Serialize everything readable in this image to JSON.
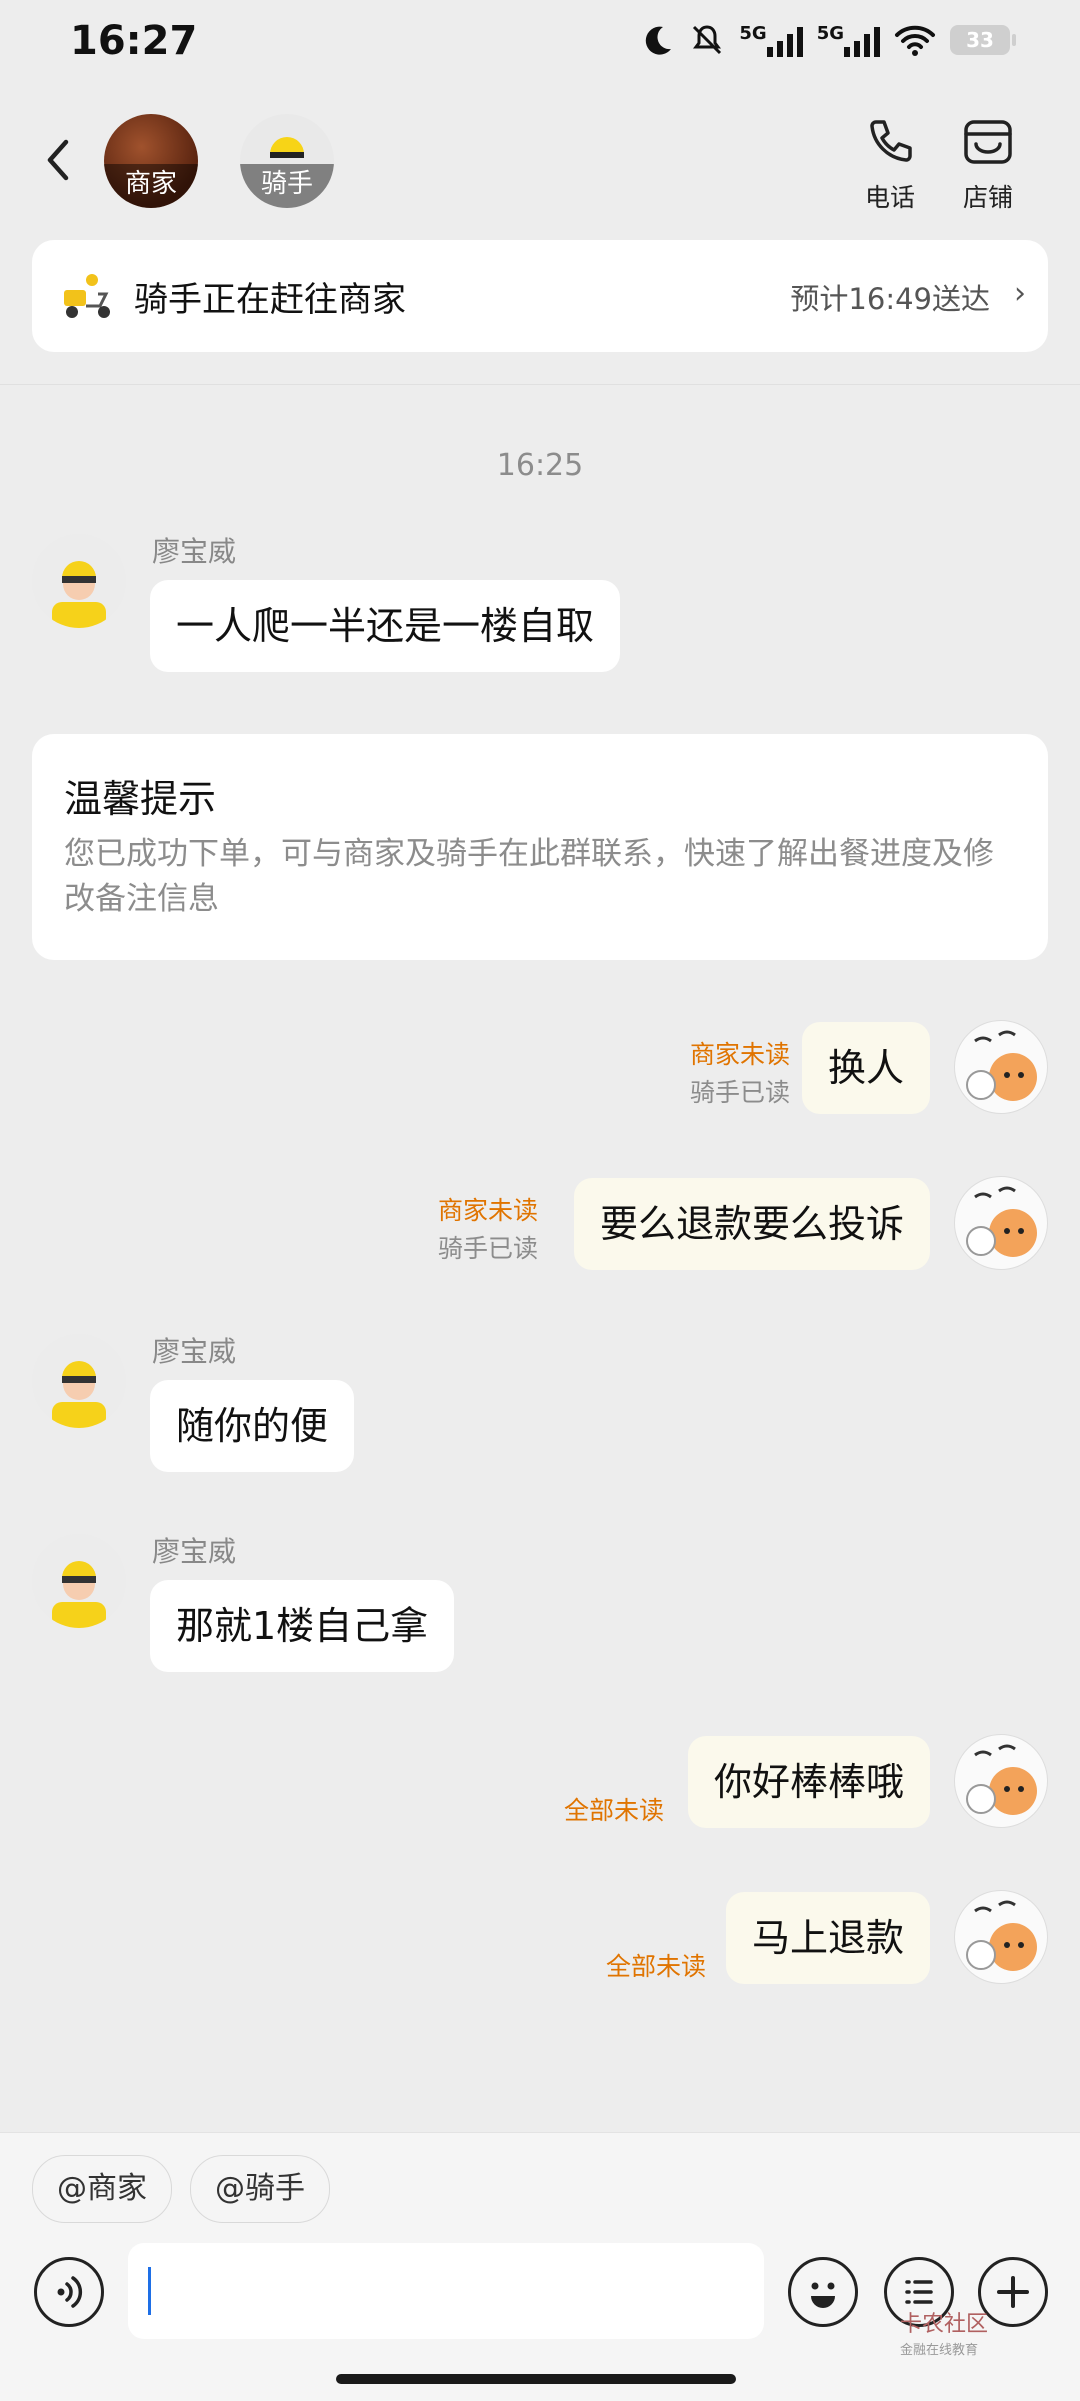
{
  "status_bar": {
    "time": "16:27",
    "network_1": "5G",
    "network_2": "5G",
    "battery": "33"
  },
  "header": {
    "merchant_avatar_label": "商家",
    "rider_avatar_label": "骑手",
    "phone_label": "电话",
    "store_label": "店铺"
  },
  "delivery": {
    "status": "骑手正在赶往商家",
    "eta": "预计16:49送达"
  },
  "chat": {
    "timestamp": "16:25",
    "rider_name": "廖宝威",
    "tip_title": "温馨提示",
    "tip_body": "您已成功下单，可与商家及骑手在此群联系，快速了解出餐进度及修改备注信息",
    "messages": [
      {
        "from": "rider",
        "sender": "廖宝威",
        "text": "一人爬一半还是一楼自取"
      },
      {
        "from": "me",
        "text": "换人",
        "status_1": "商家未读",
        "status_2": "骑手已读"
      },
      {
        "from": "me",
        "text": "要么退款要么投诉",
        "status_1": "商家未读",
        "status_2": "骑手已读"
      },
      {
        "from": "rider",
        "sender": "廖宝威",
        "text": "随你的便"
      },
      {
        "from": "rider",
        "sender": "廖宝威",
        "text": "那就1楼自己拿"
      },
      {
        "from": "me",
        "text": "你好棒棒哦",
        "status_1": "全部未读"
      },
      {
        "from": "me",
        "text": "马上退款",
        "status_1": "全部未读"
      }
    ]
  },
  "composer": {
    "mention_merchant": "@商家",
    "mention_rider": "@骑手",
    "input_value": ""
  },
  "watermark": {
    "title": "卡农社区",
    "subtitle": "金融在线教育"
  },
  "colors": {
    "background": "#ededed",
    "outgoing_bubble": "#fbf9ec",
    "unread_orange": "#e07400",
    "read_gray": "#8c8c8c",
    "caret_blue": "#1e6fe6"
  }
}
